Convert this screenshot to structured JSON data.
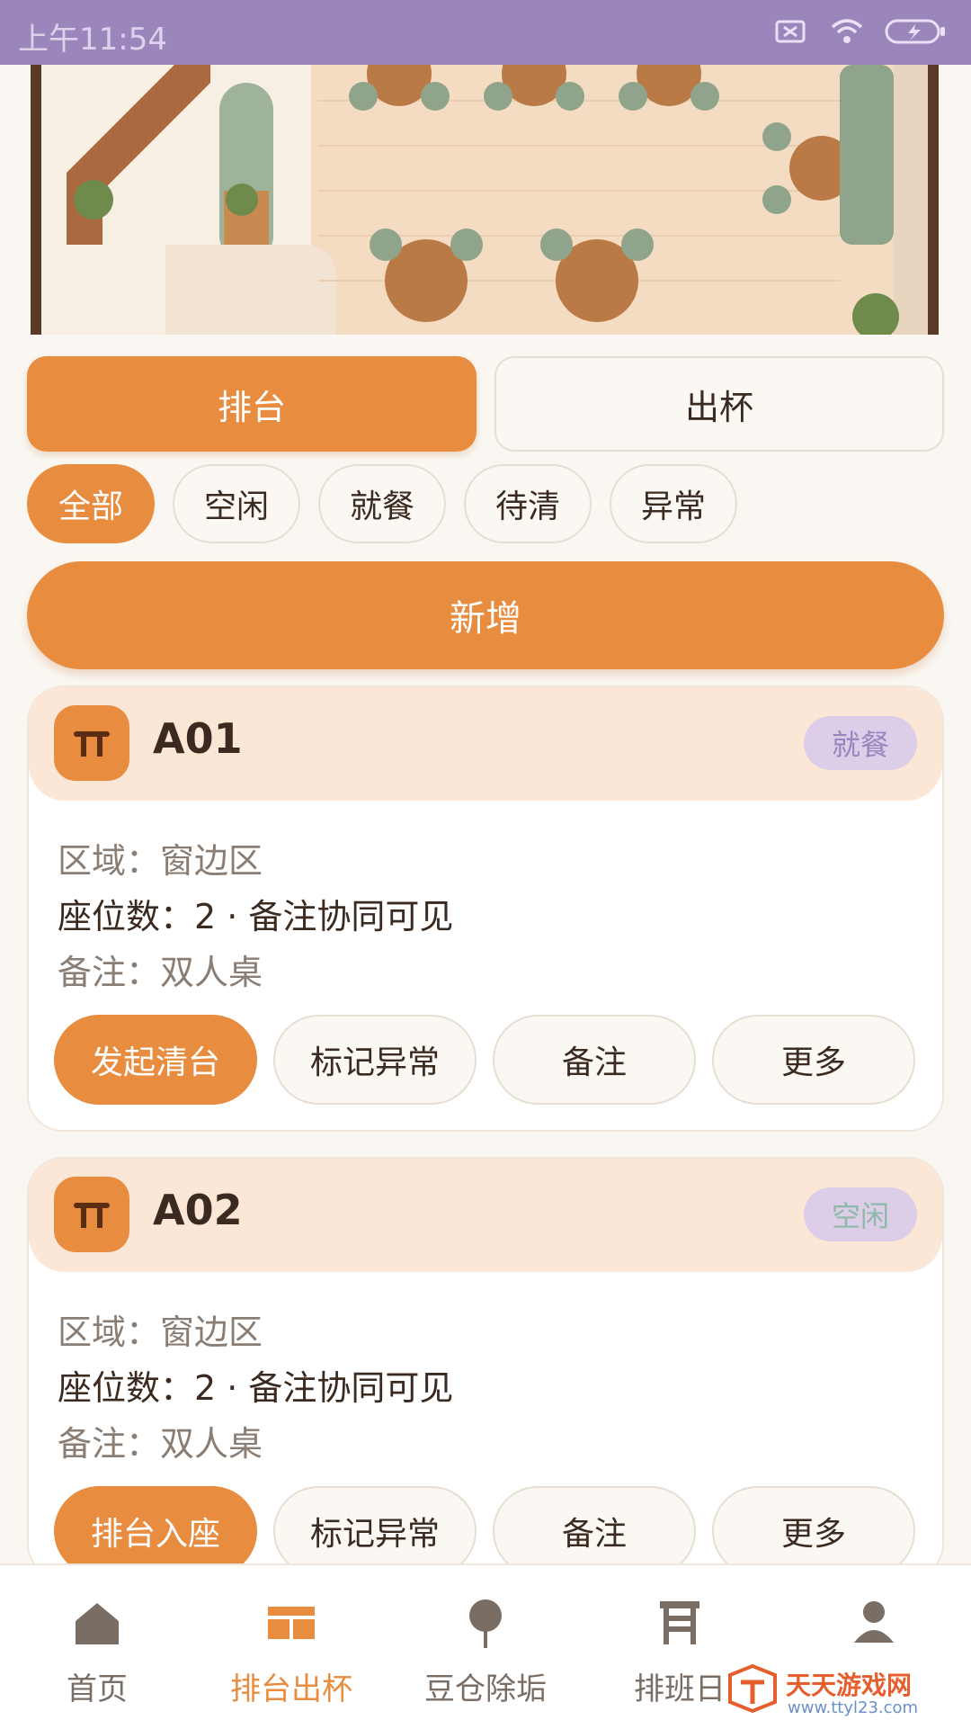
{
  "status_bar": {
    "time": "上午11:54"
  },
  "tabs": [
    {
      "label": "排台",
      "active": true
    },
    {
      "label": "出杯",
      "active": false
    }
  ],
  "filters": [
    {
      "label": "全部",
      "active": true
    },
    {
      "label": "空闲",
      "active": false
    },
    {
      "label": "就餐",
      "active": false
    },
    {
      "label": "待清",
      "active": false
    },
    {
      "label": "异常",
      "active": false
    }
  ],
  "add_button": "新增",
  "tables": [
    {
      "name": "A01",
      "status": "就餐",
      "status_color": "#9A85BE",
      "area": "区域：窗边区",
      "seats": "座位数：2 · 备注协同可见",
      "note": "备注：双人桌",
      "actions": [
        "发起清台",
        "标记异常",
        "备注",
        "更多"
      ]
    },
    {
      "name": "A02",
      "status": "空闲",
      "status_color": "#8FB9A8",
      "area": "区域：窗边区",
      "seats": "座位数：2 · 备注协同可见",
      "note": "备注：双人桌",
      "actions": [
        "排台入座",
        "标记异常",
        "备注",
        "更多"
      ]
    }
  ],
  "bottom_nav": [
    {
      "label": "首页",
      "icon": "home-icon",
      "active": false
    },
    {
      "label": "排台出杯",
      "icon": "table-layout-icon",
      "active": true
    },
    {
      "label": "豆仓除垢",
      "icon": "pin-icon",
      "active": false
    },
    {
      "label": "排班日",
      "icon": "calendar-icon",
      "active": false
    },
    {
      "label": "",
      "icon": "user-icon",
      "active": false
    }
  ],
  "watermark": {
    "title": "天天游戏网",
    "url": "www.ttyl23.com"
  },
  "colors": {
    "accent": "#E88C3F",
    "statusbar": "#9B86BC",
    "card_head": "#FCE7D6"
  }
}
